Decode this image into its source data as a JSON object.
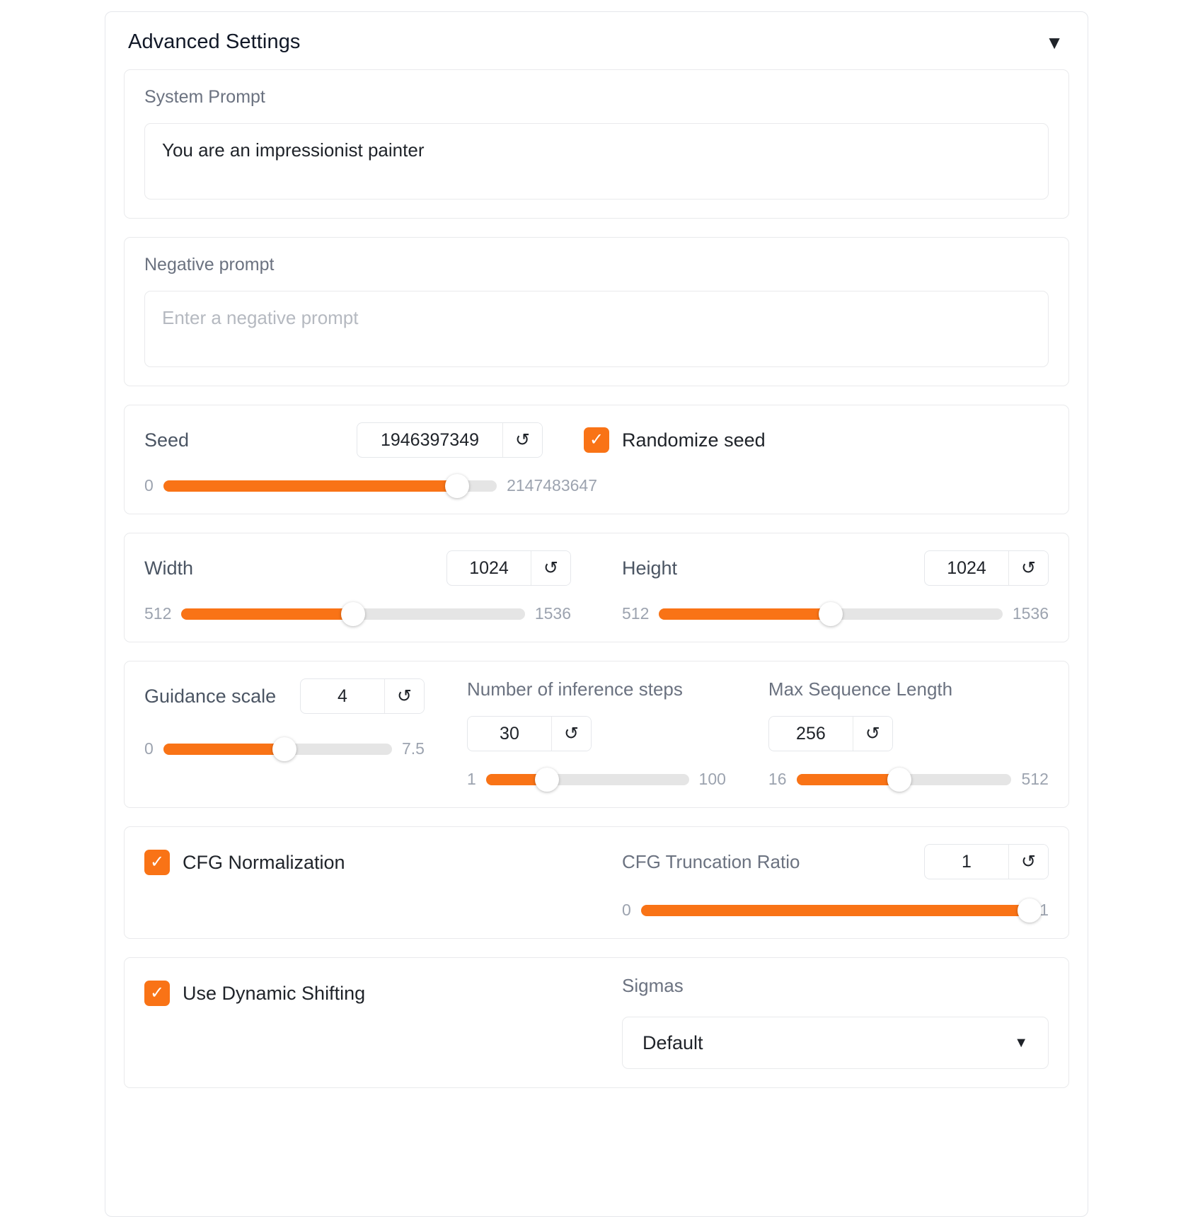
{
  "panel": {
    "title": "Advanced Settings",
    "collapse_icon": "▼"
  },
  "system_prompt": {
    "label": "System Prompt",
    "value": "You are an impressionist painter"
  },
  "negative_prompt": {
    "label": "Negative prompt",
    "value": "",
    "placeholder": "Enter a negative prompt"
  },
  "seed": {
    "label": "Seed",
    "value": "1946397349",
    "revert_icon": "↺",
    "min": "0",
    "max": "2147483647",
    "percent": 88,
    "randomize_label": "Randomize seed",
    "randomize_checked": true,
    "check_icon": "✓"
  },
  "width": {
    "label": "Width",
    "value": "1024",
    "revert_icon": "↺",
    "min": "512",
    "max": "1536",
    "percent": 50
  },
  "height": {
    "label": "Height",
    "value": "1024",
    "revert_icon": "↺",
    "min": "512",
    "max": "1536",
    "percent": 50
  },
  "guidance_scale": {
    "label": "Guidance scale",
    "value": "4",
    "revert_icon": "↺",
    "min": "0",
    "max": "7.5",
    "percent": 53
  },
  "inference_steps": {
    "label": "Number of inference steps",
    "value": "30",
    "revert_icon": "↺",
    "min": "1",
    "max": "100",
    "percent": 30
  },
  "max_sequence_length": {
    "label": "Max Sequence Length",
    "value": "256",
    "revert_icon": "↺",
    "min": "16",
    "max": "512",
    "percent": 48
  },
  "cfg_normalization": {
    "label": "CFG Normalization",
    "checked": true,
    "check_icon": "✓"
  },
  "cfg_truncation_ratio": {
    "label": "CFG Truncation Ratio",
    "value": "1",
    "revert_icon": "↺",
    "min": "0",
    "max": "1",
    "percent": 100
  },
  "dynamic_shifting": {
    "label": "Use Dynamic Shifting",
    "checked": true,
    "check_icon": "✓"
  },
  "sigmas": {
    "label": "Sigmas",
    "selected": "Default",
    "chevron_icon": "▼"
  },
  "colors": {
    "accent": "#f97316",
    "track": "#e5e5e5",
    "border": "#e9eaec",
    "muted_text": "#9ca3af"
  }
}
